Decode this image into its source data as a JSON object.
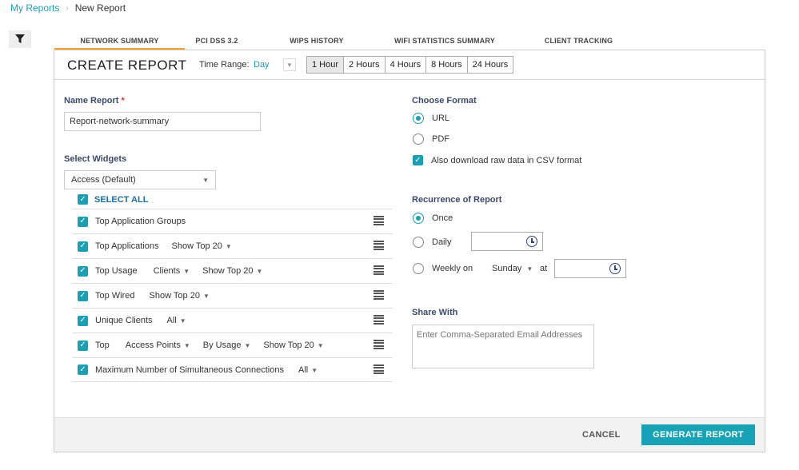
{
  "breadcrumb": {
    "root": "My Reports",
    "current": "New Report"
  },
  "tabs": [
    "NETWORK SUMMARY",
    "PCI DSS 3.2",
    "WIPS HISTORY",
    "WIFI STATISTICS SUMMARY",
    "CLIENT TRACKING"
  ],
  "header": {
    "title": "CREATE REPORT",
    "time_range_label": "Time Range:",
    "time_range_value": "Day",
    "ranges": [
      "1 Hour",
      "2 Hours",
      "4 Hours",
      "8 Hours",
      "24 Hours"
    ],
    "active_range": "1 Hour"
  },
  "name_report": {
    "label": "Name Report",
    "required_mark": "*",
    "value": "Report-network-summary"
  },
  "widgets": {
    "label": "Select Widgets",
    "dropdown": "Access (Default)",
    "select_all": "SELECT ALL",
    "rows": [
      {
        "name": "Top Application Groups",
        "options": []
      },
      {
        "name": "Top Applications",
        "options": [
          "Show Top 20"
        ]
      },
      {
        "name": "Top Usage",
        "options": [
          "Clients",
          "Show Top 20"
        ]
      },
      {
        "name": "Top Wired",
        "options": [
          "Show Top 20"
        ]
      },
      {
        "name": "Unique Clients",
        "options": [
          "All"
        ]
      },
      {
        "name": "Top",
        "options": [
          "Access Points",
          "By Usage",
          "Show Top 20"
        ]
      },
      {
        "name": "Maximum Number of Simultaneous Connections",
        "options": [
          "All"
        ]
      }
    ]
  },
  "format": {
    "label": "Choose Format",
    "options": [
      "URL",
      "PDF"
    ],
    "selected": "URL",
    "csv_label": "Also download raw data in CSV format",
    "csv_checked": true
  },
  "recurrence": {
    "label": "Recurrence of Report",
    "once": "Once",
    "daily": "Daily",
    "weekly": "Weekly on",
    "weekday": "Sunday",
    "at": "at",
    "selected": "Once"
  },
  "share": {
    "label": "Share With",
    "placeholder": "Enter Comma-Separated Email Addresses"
  },
  "footer": {
    "cancel": "CANCEL",
    "generate": "GENERATE REPORT"
  },
  "colors": {
    "accent": "#17a2b8",
    "tab_underline": "#f0a030",
    "heading": "#3b4a6b"
  }
}
